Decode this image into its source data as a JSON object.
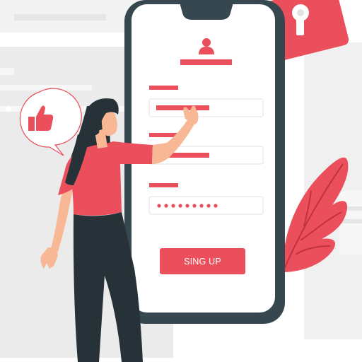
{
  "signup_form": {
    "button_label": "SING UP",
    "password_mask": "•••••••••"
  },
  "icons": {
    "user": "user-icon",
    "padlock": "padlock-icon",
    "thumbs_up": "thumbs-up-icon",
    "leaf": "leaf-decoration"
  },
  "colors": {
    "accent": "#ea4f5b",
    "phone_frame": "#37474f",
    "background_panel": "#ebebeb",
    "text_dark": "#263238"
  }
}
